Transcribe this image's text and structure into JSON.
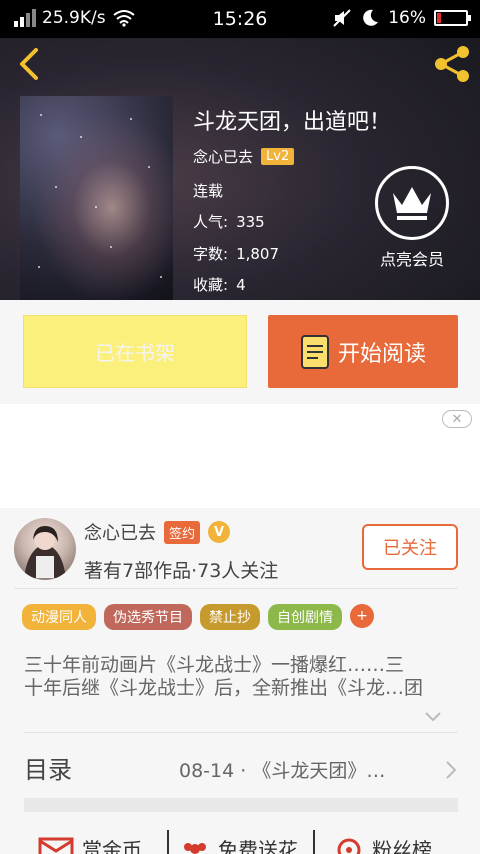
{
  "status_bar": {
    "speed": "25.9K/s",
    "time": "15:26",
    "battery": "16%",
    "battery_level": 0.16
  },
  "book": {
    "title": "斗龙天团，出道吧！",
    "author": "念心已去",
    "level": "Lv2",
    "status": "连载",
    "popularity_label": "人气:",
    "popularity_value": "335",
    "words_label": "字数:",
    "words_value": "1,807",
    "favorites_label": "收藏:",
    "favorites_value": "4"
  },
  "vip": {
    "label": "点亮会员"
  },
  "actions": {
    "shelf_label": "已在书架",
    "read_label": "开始阅读"
  },
  "ad": {
    "close_label": "✕"
  },
  "author_card": {
    "name": "念心已去",
    "sign_badge": "签约",
    "v_badge": "V",
    "stats": "著有7部作品·73人关注",
    "follow_label": "已关注"
  },
  "tags": [
    {
      "label": "动漫同人",
      "color": "#f2b33a"
    },
    {
      "label": "伪选秀节目",
      "color": "#c0685c"
    },
    {
      "label": "禁止抄",
      "color": "#c79a2e"
    },
    {
      "label": "自创剧情",
      "color": "#8db94b"
    }
  ],
  "tag_more": "+",
  "intro": {
    "line1": "三十年前动画片《斗龙战士》一播爆红……三",
    "line2": "十年后继《斗龙战士》后，全新推出《斗龙…团"
  },
  "toc": {
    "title": "目录",
    "latest": "08-14 · 《斗龙天团》…"
  },
  "bottom_row": {
    "reward": "赏金币",
    "flowers": "免费送花",
    "fans": "粉丝榜"
  },
  "colors": {
    "accent": "#e8693a",
    "shelf": "#fcf07c",
    "gold": "#f2b33a"
  }
}
